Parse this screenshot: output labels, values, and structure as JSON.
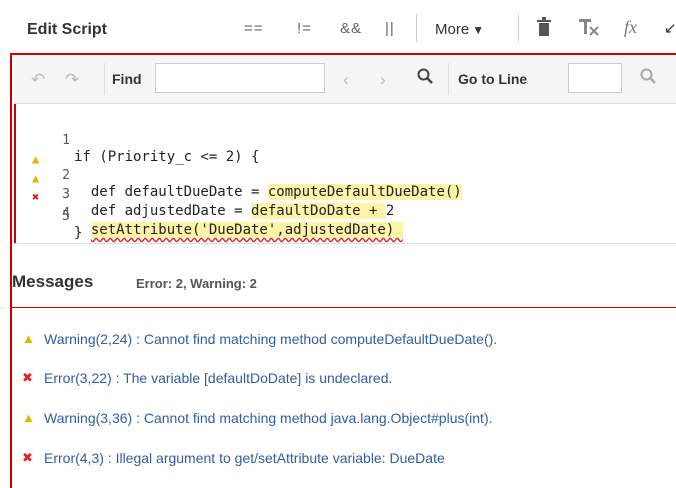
{
  "header": {
    "title": "Edit Script",
    "ops": [
      "==",
      "!=",
      "&&",
      "||"
    ],
    "more_label": "More",
    "icons": [
      "trash-icon",
      "clear-format-icon",
      "function-icon",
      "collapse-icon"
    ]
  },
  "findbar": {
    "find_label": "Find",
    "find_value": "",
    "goto_label": "Go to Line",
    "goto_value": ""
  },
  "code": {
    "lines": [
      {
        "num": "1",
        "marker": "",
        "text": "if (Priority_c <= 2) {"
      },
      {
        "num": "2",
        "marker": "warning",
        "text": "  def defaultDueDate = computeDefaultDueDate()"
      },
      {
        "num": "3",
        "marker": "warning",
        "text": "  def adjustedDate = defaultDoDate + 2"
      },
      {
        "num": "4",
        "marker": "error",
        "text": "  setAttribute('DueDate',adjustedDate)"
      },
      {
        "num": "5",
        "marker": "",
        "text": "}"
      }
    ]
  },
  "messages": {
    "title": "Messages",
    "summary": "Error: 2, Warning: 2",
    "items": [
      {
        "type": "warning",
        "text": "Warning(2,24) : Cannot find matching method computeDefaultDueDate()."
      },
      {
        "type": "error",
        "text": "Error(3,22) : The variable [defaultDoDate] is undeclared."
      },
      {
        "type": "warning",
        "text": "Warning(3,36) : Cannot find matching method java.lang.Object#plus(int)."
      },
      {
        "type": "error",
        "text": "Error(4,3) : Illegal argument to get/setAttribute variable: DueDate"
      }
    ]
  },
  "colors": {
    "error": "#d9242b",
    "warning": "#e5b400",
    "link": "#2f5f9f",
    "border": "#cc0000"
  }
}
